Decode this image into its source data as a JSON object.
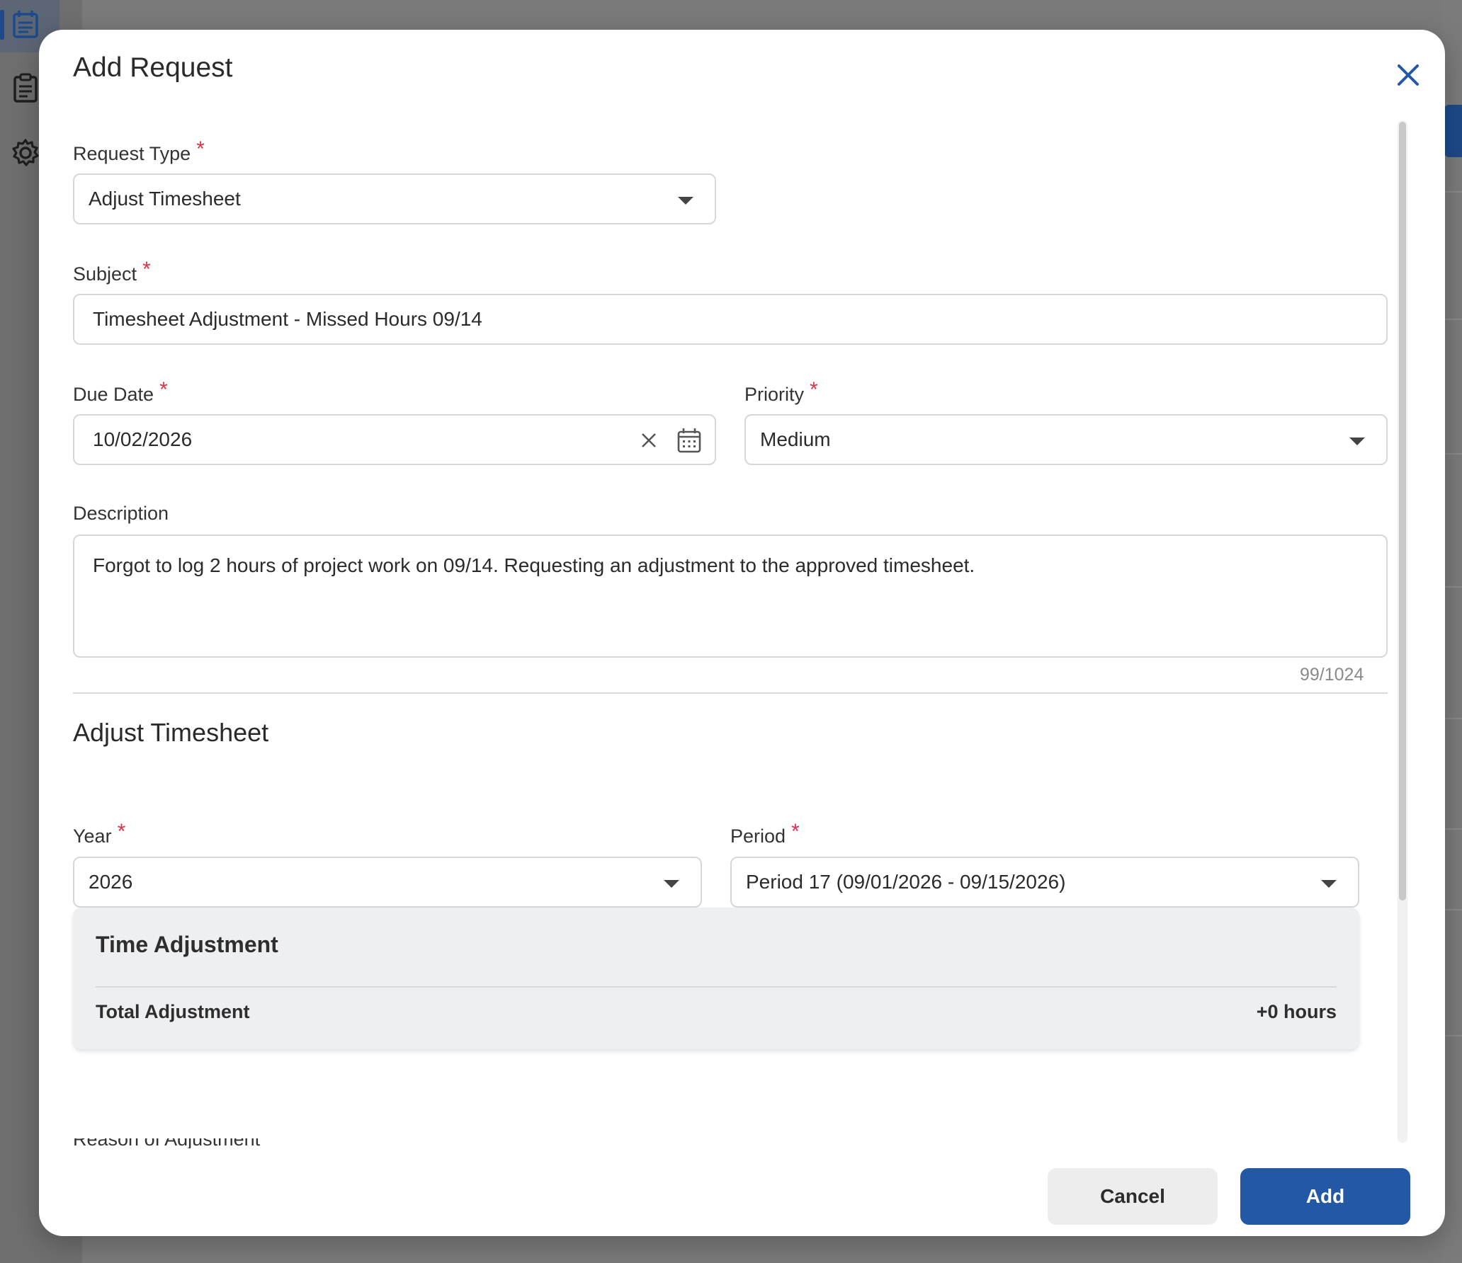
{
  "modal": {
    "title": "Add Request",
    "close_label": "close"
  },
  "form": {
    "request_type": {
      "label": "Request Type",
      "required_mark": "*",
      "value": "Adjust Timesheet"
    },
    "subject": {
      "label": "Subject",
      "required_mark": "*",
      "value": "Timesheet Adjustment - Missed Hours 09/14"
    },
    "due_date": {
      "label": "Due Date",
      "required_mark": "*",
      "value": "10/02/2026"
    },
    "priority": {
      "label": "Priority",
      "required_mark": "*",
      "value": "Medium"
    },
    "description": {
      "label": "Description",
      "value": "Forgot to log 2 hours of project work on 09/14. Requesting an adjustment to the approved timesheet.",
      "counter": "99/1024"
    }
  },
  "adjust_section": {
    "title": "Adjust Timesheet",
    "year": {
      "label": "Year",
      "required_mark": "*",
      "value": "2026"
    },
    "period": {
      "label": "Period",
      "required_mark": "*",
      "value": "Period 17 (09/01/2026 - 09/15/2026)"
    },
    "time_adjustment": {
      "title": "Time Adjustment",
      "total_label": "Total Adjustment",
      "total_value": "+0 hours"
    },
    "reason": {
      "label": "Reason of Adjustment",
      "required_mark": "*"
    }
  },
  "footer": {
    "cancel_label": "Cancel",
    "add_label": "Add"
  },
  "colors": {
    "accent": "#2358a6",
    "required": "#d9344a",
    "overlay": "#7a7a7a"
  }
}
